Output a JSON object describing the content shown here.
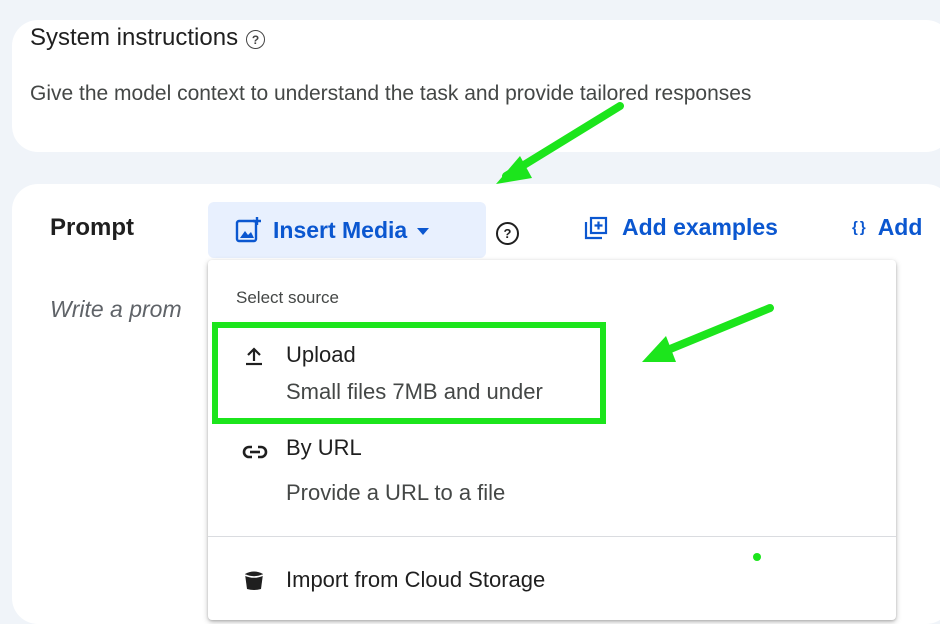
{
  "system_instructions": {
    "title": "System instructions",
    "help_glyph": "?",
    "description": "Give the model context to understand the task and provide tailored responses"
  },
  "prompt": {
    "label": "Prompt",
    "placeholder": "Write a prom",
    "help_glyph": "?"
  },
  "toolbar": {
    "insert_media_label": "Insert Media",
    "add_examples_label": "Add examples",
    "add_more_label": "Add",
    "add_more_icon_glyph": "{}"
  },
  "menu": {
    "header": "Select source",
    "items": [
      {
        "title": "Upload",
        "subtitle": "Small files 7MB and under",
        "icon": "upload-icon"
      },
      {
        "title": "By URL",
        "subtitle": "Provide a URL to a file",
        "icon": "link-icon"
      },
      {
        "title": "Import from Cloud Storage",
        "icon": "cloud-storage-icon"
      }
    ]
  },
  "colors": {
    "accent": "#0b57d0",
    "annotation_green": "#1ce51c",
    "page_bg": "#f0f4f9"
  }
}
